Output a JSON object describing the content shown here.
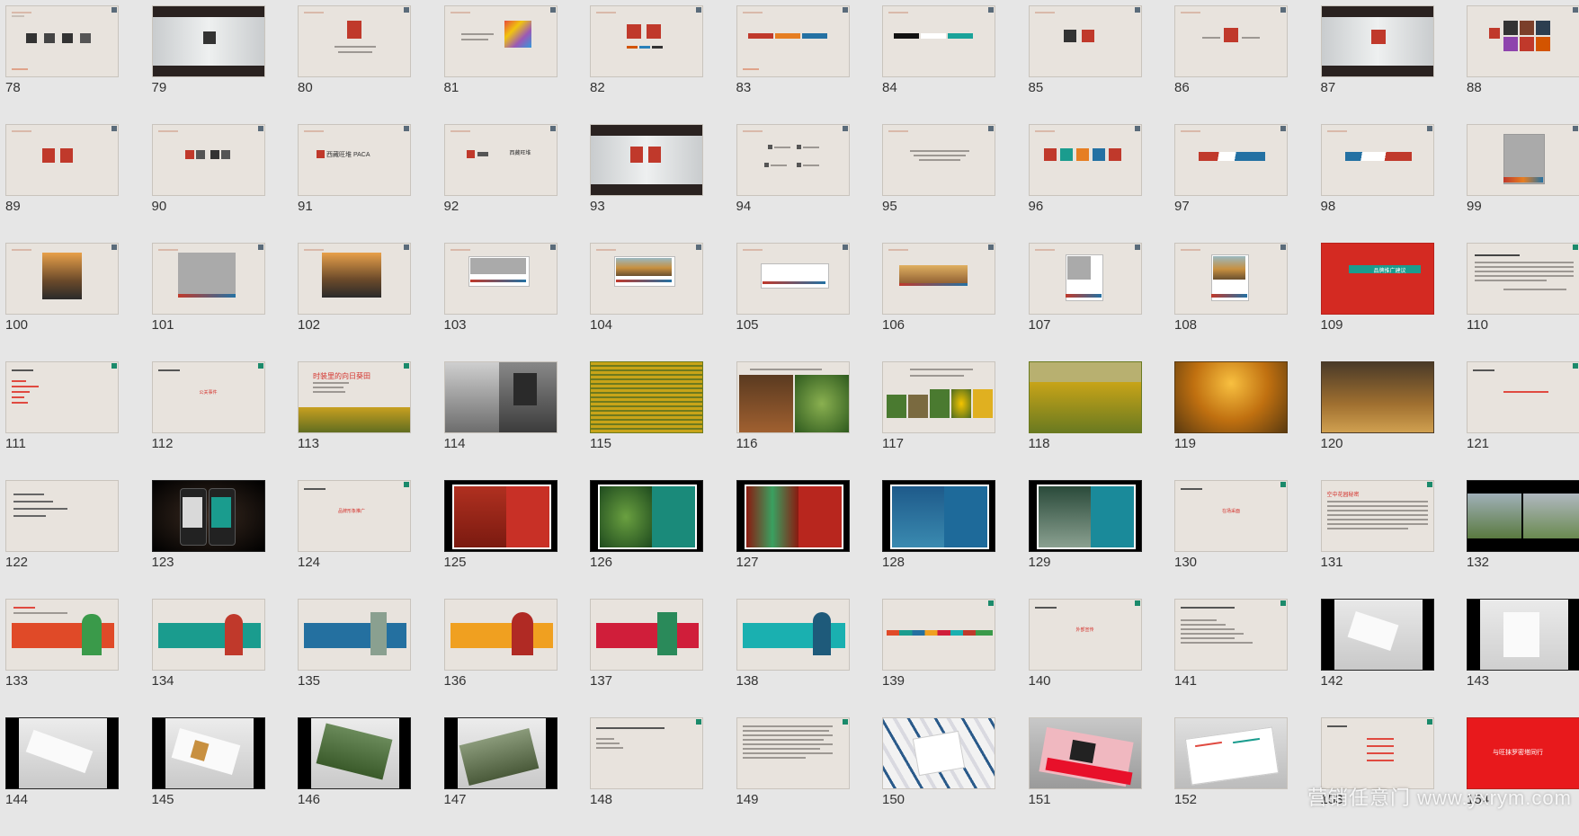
{
  "watermark": "营销任意门 www.yxrym.com",
  "slides": [
    {
      "num": "78"
    },
    {
      "num": "79"
    },
    {
      "num": "80"
    },
    {
      "num": "81"
    },
    {
      "num": "82"
    },
    {
      "num": "83"
    },
    {
      "num": "84"
    },
    {
      "num": "85"
    },
    {
      "num": "86"
    },
    {
      "num": "87"
    },
    {
      "num": "88"
    },
    {
      "num": "89"
    },
    {
      "num": "90"
    },
    {
      "num": "91",
      "text": "西藏旺堆 PACA"
    },
    {
      "num": "92",
      "text": "西藏旺堆"
    },
    {
      "num": "93"
    },
    {
      "num": "94"
    },
    {
      "num": "95"
    },
    {
      "num": "96"
    },
    {
      "num": "97"
    },
    {
      "num": "98"
    },
    {
      "num": "99"
    },
    {
      "num": "100"
    },
    {
      "num": "101"
    },
    {
      "num": "102"
    },
    {
      "num": "103"
    },
    {
      "num": "104"
    },
    {
      "num": "105"
    },
    {
      "num": "106"
    },
    {
      "num": "107"
    },
    {
      "num": "108"
    },
    {
      "num": "109",
      "text": "品牌推广建议"
    },
    {
      "num": "110"
    },
    {
      "num": "111"
    },
    {
      "num": "112",
      "text": "公关事件"
    },
    {
      "num": "113",
      "text": "时装里的向日葵田"
    },
    {
      "num": "114"
    },
    {
      "num": "115"
    },
    {
      "num": "116"
    },
    {
      "num": "117"
    },
    {
      "num": "118"
    },
    {
      "num": "119"
    },
    {
      "num": "120"
    },
    {
      "num": "121"
    },
    {
      "num": "122"
    },
    {
      "num": "123"
    },
    {
      "num": "124",
      "text": "品牌形象推广"
    },
    {
      "num": "125"
    },
    {
      "num": "126"
    },
    {
      "num": "127"
    },
    {
      "num": "128"
    },
    {
      "num": "129"
    },
    {
      "num": "130",
      "text": "在场采面"
    },
    {
      "num": "131",
      "text": "空中花园秘密"
    },
    {
      "num": "132"
    },
    {
      "num": "133"
    },
    {
      "num": "134"
    },
    {
      "num": "135"
    },
    {
      "num": "136"
    },
    {
      "num": "137"
    },
    {
      "num": "138"
    },
    {
      "num": "139"
    },
    {
      "num": "140",
      "text": "外部宣传"
    },
    {
      "num": "141"
    },
    {
      "num": "142"
    },
    {
      "num": "143"
    },
    {
      "num": "144"
    },
    {
      "num": "145"
    },
    {
      "num": "146"
    },
    {
      "num": "147"
    },
    {
      "num": "148"
    },
    {
      "num": "149"
    },
    {
      "num": "150"
    },
    {
      "num": "151"
    },
    {
      "num": "152"
    },
    {
      "num": "153"
    },
    {
      "num": "154",
      "text": "与旺抹罗密塔同行"
    }
  ]
}
